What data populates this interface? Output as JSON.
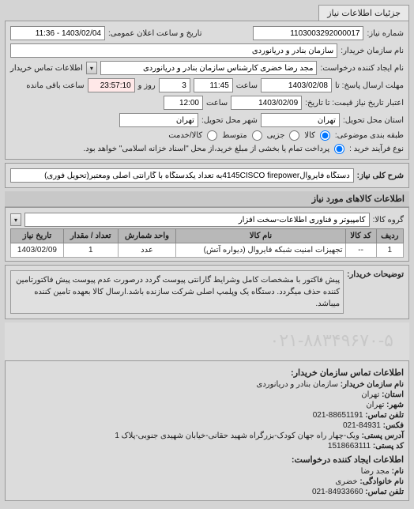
{
  "header": {
    "tab": "جزئیات اطلاعات نیاز"
  },
  "fields": {
    "need_no_label": "شماره نیاز:",
    "need_no": "1103003292000017",
    "public_date_label": "تاریخ و ساعت اعلان عمومی:",
    "public_date": "1403/02/04 - 11:36",
    "buyer_org_label": "نام سازمان خریدار:",
    "buyer_org": "سازمان بنادر و دریانوردی",
    "requester_label": "نام ایجاد کننده درخواست:",
    "requester": "مجد رضا خضری کارشناس سازمان بنادر و دریانوردی",
    "buyer_contact_btn": "اطلاعات تماس خریدار",
    "reply_deadline_label": "مهلت ارسال پاسخ: تا",
    "reply_date": "1403/02/08",
    "reply_time_label": "ساعت",
    "reply_time": "11:45",
    "days_label": "روز و",
    "days": "3",
    "remaining_label": "ساعت باقی مانده",
    "remaining": "23:57:10",
    "validity_label": "اعتبار تاریخ نیاز قیمت: تا تاریخ:",
    "validity_date": "1403/02/09",
    "validity_time_label": "ساعت",
    "validity_time": "12:00",
    "delivery_province_label": "استان محل تحویل:",
    "delivery_province": "تهران",
    "delivery_city_label": "شهر محل تحویل:",
    "delivery_city": "تهران",
    "category_label": "طبقه بندی موضوعی:",
    "goods_label": "کالا",
    "partial_label": "جزیی",
    "medium_label": "متوسط",
    "service_label": "کالا/خدمت",
    "purchase_process_label": "نوع فرآیند خرید :",
    "purchase_process_text": "پرداخت تمام یا بخشی از مبلغ خرید،از محل \"اسناد خزانه اسلامی\" خواهد بود.",
    "general_title_label": "شرح کلی نیاز:",
    "general_title": "دستگاه فایروال4145CISCO firepowerبه تعداد یکدستگاه با گارانتی اصلی ومعتبر(تحویل فوری)",
    "items_section_title": "اطلاعات کالاهای مورد نیاز",
    "item_group_label": "گروه کالا:",
    "item_group": "کامپیوتر و فناوری اطلاعات-سخت افزار",
    "buyer_note_label": "توضیحات خریدار:",
    "buyer_note": "پیش فاکتور با مشخصات کامل وشرایط گارانتی پیوست گردد درصورت عدم پیوست پیش فاکتورتامین کننده حذف میگردد. دستگاه یک وپلمپ اصلی شرکت سازنده باشد.ارسال کالا بعهده تامین کننده میباشد.",
    "contact_section_title": "اطلاعات تماس سازمان خریدار:",
    "c_buyer_name_label": "نام سازمان خریدار:",
    "c_buyer_name": "سازمان بنادر و دریانوردی",
    "c_province_label": "استان:",
    "c_province": "تهران",
    "c_city_label": "شهر:",
    "c_city": "تهران",
    "c_phone_label": "تلفن تماس:",
    "c_phone": "021-88651191",
    "c_fax_label": "فکس:",
    "c_fax": "021-84931",
    "c_address_label": "آدرس پستی:",
    "c_address": "ویک-چهار راه جهان کودک-بزرگراه شهید حقانی-خیابان شهیدی جنوبی-پلاک 1",
    "c_postal_label": "کد پستی:",
    "c_postal": "1518663111",
    "creator_info_label": "اطلاعات ایجاد کننده درخواست:",
    "creator_name_label": "نام:",
    "creator_name": "مجد رضا",
    "creator_family_label": "نام خانوادگی:",
    "creator_family": "خضری",
    "creator_phone_label": "تلفن تماس:",
    "creator_phone": "021-84933660",
    "watermark": "۰۲۱-۸۸۳۴۹۶۷۰-۵"
  },
  "table": {
    "headers": {
      "row": "ردیف",
      "code": "کد کالا",
      "name": "نام کالا",
      "unit": "واحد شمارش",
      "qty": "تعداد / مقدار",
      "date": "تاریخ نیاز"
    },
    "rows": [
      {
        "row": "1",
        "code": "--",
        "name": "تجهیزات امنیت شبکه فایروال (دیواره آتش)",
        "unit": "عدد",
        "qty": "1",
        "date": "1403/02/09"
      }
    ]
  }
}
